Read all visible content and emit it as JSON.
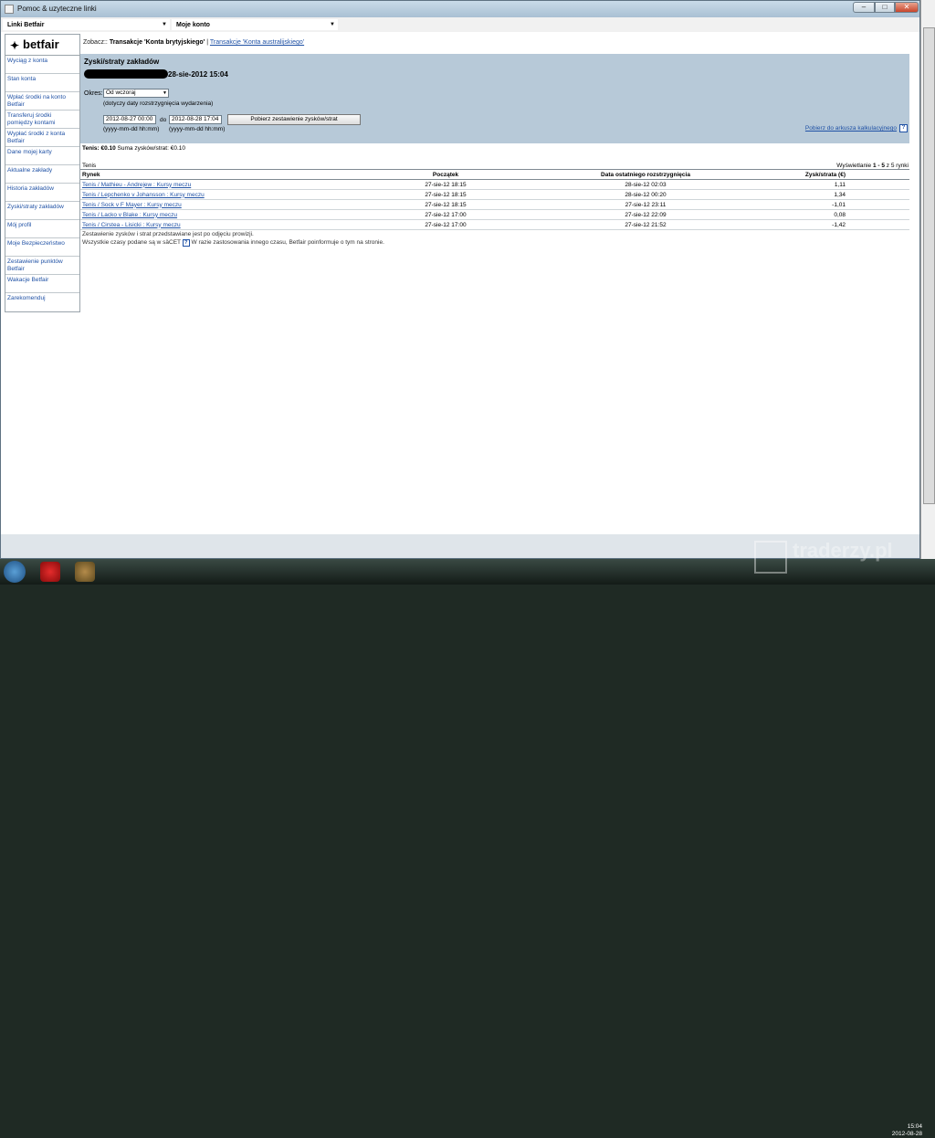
{
  "window": {
    "title": "Pomoc & uzyteczne linki",
    "min_glyph": "–",
    "max_glyph": "□",
    "close_glyph": "✕"
  },
  "combos": {
    "left_value": "Linki Betfair",
    "right_value": "Moje konto",
    "arrow_glyph": "▼"
  },
  "logo": {
    "text": "betfair",
    "mark": "✦"
  },
  "sidebar": {
    "items": [
      {
        "label": "Wyciąg z konta"
      },
      {
        "label": "Stan konta"
      },
      {
        "label": "Wpłać środki na konto Betfair"
      },
      {
        "label": "Transferuj środki pomiędzy kontami"
      },
      {
        "label": "Wypłać środki z konta Betfair"
      },
      {
        "label": "Dane mojej karty"
      },
      {
        "label": "Aktualne zakłady"
      },
      {
        "label": "Historia zakładów"
      },
      {
        "label": "Zyski/straty zakładów"
      },
      {
        "label": "Mój profil"
      },
      {
        "label": "Moje Bezpieczeństwo"
      },
      {
        "label": "Zestawienie punktów Betfair"
      },
      {
        "label": "Wakacje Betfair"
      },
      {
        "label": "Zarekomenduj"
      }
    ]
  },
  "see_also": {
    "prefix": "Zobacz::",
    "current": "Transakcje 'Konta brytyjskiego'",
    "separator": "|",
    "link": "Transakcje 'Konta australijskiego'"
  },
  "panel": {
    "title": "Zyski/straty zakładów",
    "date_heading": "28-sie-2012 15:04",
    "period_label": "Okres:",
    "period_value": "Od wczoraj",
    "period_note": "(dotyczy daty rozstrzygnięcia wydarzenia)",
    "date_from": "2012-08-27 00:00",
    "to_label": "do",
    "date_to": "2012-08-28 17:04",
    "format_from": "(yyyy-mm-dd hh:mm)",
    "format_to": "(yyyy-mm-dd hh:mm)",
    "fetch_button": "Pobierz zestawienie zysków/strat",
    "download_link": "Pobierz do arkusza kalkulacyjnego",
    "help_glyph": "?"
  },
  "summary": {
    "sport": "Tenis: €0.10",
    "total_label": "Suma zysków/strat:",
    "total_value": "€0.10"
  },
  "results": {
    "section": "Tenis",
    "showing_prefix": "Wyświetlanie",
    "showing_range": "1 - 5",
    "showing_suffix": "z 5 rynki",
    "headers": {
      "market": "Rynek",
      "start": "Początek",
      "settled": "Data ostatniego rozstrzygnięcia",
      "pl": "Zysk/strata (€)"
    },
    "rows": [
      {
        "market": "Tenis / Mathieu - Andrejew : Kursy meczu",
        "start": "27-sie-12 18:15",
        "settled": "28-sie-12 02:03",
        "pl": "1,11"
      },
      {
        "market": "Tenis / Lepchenko v Johansson : Kursy meczu",
        "start": "27-sie-12 18:15",
        "settled": "28-sie-12 00:20",
        "pl": "1,34"
      },
      {
        "market": "Tenis / Sock v F Mayer : Kursy meczu",
        "start": "27-sie-12 18:15",
        "settled": "27-sie-12 23:11",
        "pl": "-1,01"
      },
      {
        "market": "Tenis / Lacko v Blake : Kursy meczu",
        "start": "27-sie-12 17:00",
        "settled": "27-sie-12 22:09",
        "pl": "0,08"
      },
      {
        "market": "Tenis / Cirstea - Lisicki : Kursy meczu",
        "start": "27-sie-12 17:00",
        "settled": "27-sie-12 21:52",
        "pl": "-1,42"
      }
    ],
    "footnote1": "Zestawienie zysków i strat przedstawiane jest po odjęciu prowizji.",
    "footnote2_a": "Wszystkie czasy podane są w säCET",
    "footnote2_b": "W razie zastosowania innego czasu, Betfair poinformuje o tym na stronie."
  },
  "taskbar": {
    "watermark": "traderzy.pl",
    "time": "15:04",
    "date": "2012-08-28"
  }
}
